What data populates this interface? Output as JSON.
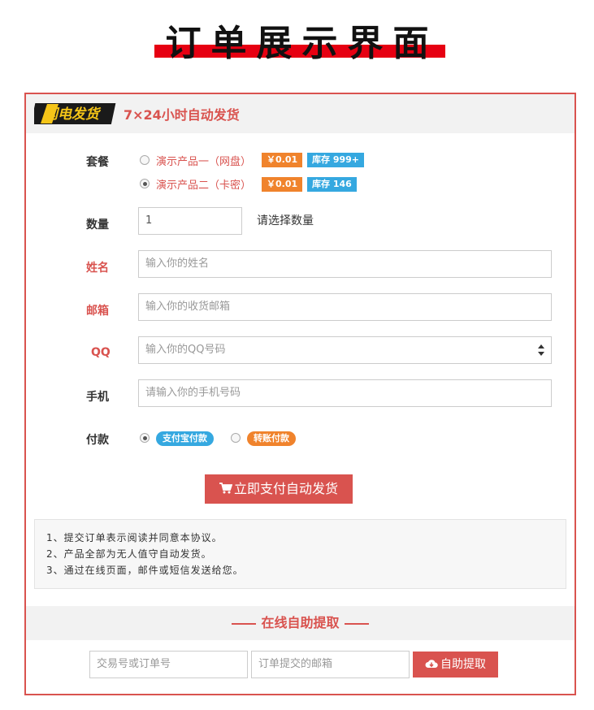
{
  "page": {
    "title": "订单展示界面"
  },
  "header": {
    "logo_text": "闪电发货",
    "subtitle": "7×24小时自动发货"
  },
  "form": {
    "package_label": "套餐",
    "packages": [
      {
        "name": "演示产品一（网盘）",
        "price": "￥0.01",
        "stock": "库存 999+",
        "checked": false
      },
      {
        "name": "演示产品二（卡密）",
        "price": "￥0.01",
        "stock": "库存 146",
        "checked": true
      }
    ],
    "quantity_label": "数量",
    "quantity_value": "1",
    "quantity_hint": "请选择数量",
    "name_label": "姓名",
    "name_placeholder": "输入你的姓名",
    "email_label": "邮箱",
    "email_placeholder": "输入你的收货邮箱",
    "qq_label": "QQ",
    "qq_placeholder": "输入你的QQ号码",
    "phone_label": "手机",
    "phone_placeholder": "请输入你的手机号码",
    "payment_label": "付款",
    "payment_options": [
      {
        "label": "支付宝付款",
        "checked": true,
        "color": "#35a8e0"
      },
      {
        "label": "转账付款",
        "checked": false,
        "color": "#f0832c"
      }
    ],
    "submit_label": "立即支付自动发货"
  },
  "notes": [
    "1、提交订单表示阅读并同意本协议。",
    "2、产品全部为无人值守自动发货。",
    "3、通过在线页面，邮件或短信发送给您。"
  ],
  "fetch": {
    "title": "在线自助提取",
    "order_placeholder": "交易号或订单号",
    "email_placeholder": "订单提交的邮箱",
    "button_label": "自助提取"
  },
  "colors": {
    "accent": "#d9534f",
    "orange": "#f0832c",
    "blue": "#35a8e0"
  }
}
